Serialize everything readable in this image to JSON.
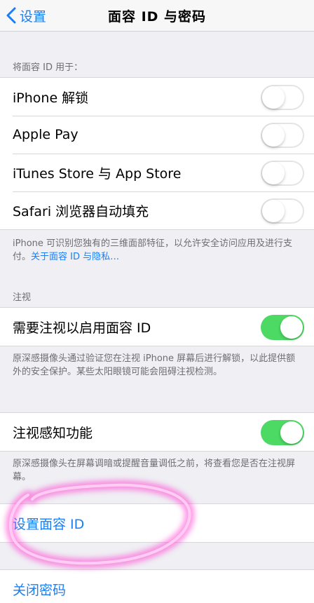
{
  "nav": {
    "back_label": "设置",
    "title": "面容 ID 与密码"
  },
  "use_face_id": {
    "header": "将面容 ID 用于：",
    "rows": [
      {
        "label": "iPhone 解锁",
        "toggle": "off"
      },
      {
        "label": "Apple Pay",
        "toggle": "off"
      },
      {
        "label": "iTunes Store 与 App Store",
        "toggle": "off"
      },
      {
        "label": "Safari 浏览器自动填充",
        "toggle": "off"
      }
    ],
    "footer_text": "iPhone 可识别您独有的三维面部特征，以允许安全访问应用及进行支付。",
    "footer_link": "关于面容 ID 与隐私…"
  },
  "attention": {
    "header": "注视",
    "row_label": "需要注视以启用面容 ID",
    "toggle": "on",
    "footer": "原深感摄像头通过验证您在注视 iPhone 屏幕后进行解锁，以此提供额外的安全保护。某些太阳眼镜可能会阻碍注视检测。"
  },
  "awareness": {
    "row_label": "注视感知功能",
    "toggle": "on",
    "footer": "原深感摄像头在屏幕调暗或提醒音量调低之前，将查看您是否在注视屏幕。"
  },
  "setup": {
    "label": "设置面容 ID"
  },
  "passcode": {
    "label": "关闭密码"
  },
  "colors": {
    "accent": "#1a7ff5",
    "switch_on": "#4cd964",
    "background": "#efeff4",
    "annotation": "#ff3fd0"
  },
  "icons": {
    "back": "chevron-left-icon"
  }
}
